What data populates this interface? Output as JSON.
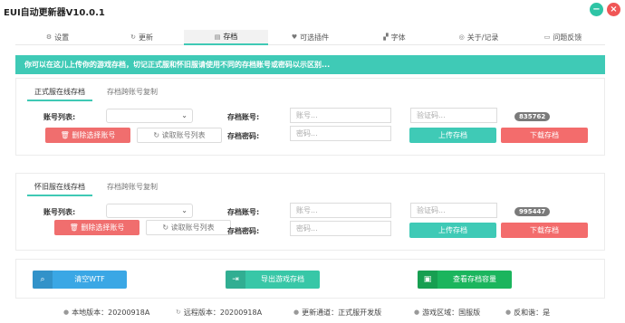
{
  "window": {
    "title": "EUI自动更新器V10.0.1",
    "minimize": "−",
    "close": "×"
  },
  "tabs": [
    {
      "icon": "⚙",
      "label": "设置"
    },
    {
      "icon": "↻",
      "label": "更新"
    },
    {
      "icon": "▤",
      "label": "存档"
    },
    {
      "icon": "♥",
      "label": "可选插件"
    },
    {
      "icon": "▞",
      "label": "字体"
    },
    {
      "icon": "◎",
      "label": "关于/记录"
    },
    {
      "icon": "▭",
      "label": "问题反馈"
    }
  ],
  "notice": "你可以在这儿上传你的游戏存档，切记正式服和怀旧服请使用不同的存档账号或密码以示区别...",
  "panel_official": {
    "subtab_active": "正式服在线存档",
    "subtab_other": "存档跨账号复制",
    "account_list_label": "账号列表:",
    "delete_btn": "删除选择账号",
    "read_btn": "读取账号列表",
    "save_account_label": "存档账号:",
    "save_password_label": "存档密码:",
    "account_placeholder": "账号...",
    "password_placeholder": "密码...",
    "captcha_placeholder": "验证码...",
    "captcha_code": "835762",
    "upload_btn": "上传存档",
    "download_btn": "下载存档"
  },
  "panel_classic": {
    "subtab_active": "怀旧服在线存档",
    "subtab_other": "存档跨账号复制",
    "account_list_label": "账号列表:",
    "delete_btn": "删除选择账号",
    "read_btn": "读取账号列表",
    "save_account_label": "存档账号:",
    "save_password_label": "存档密码:",
    "account_placeholder": "账号...",
    "password_placeholder": "密码...",
    "captcha_placeholder": "验证码...",
    "captcha_code": "995447",
    "upload_btn": "上传存档",
    "download_btn": "下载存档"
  },
  "tools": {
    "clear_wtf": "清空WTF",
    "export_save": "导出游戏存档",
    "view_capacity": "查看存档容量"
  },
  "status": [
    {
      "icon": "●",
      "text": "本地版本：20200918A"
    },
    {
      "icon": "↻",
      "text": "远程版本：20200918A"
    },
    {
      "icon": "●",
      "text": "更新通道：正式服开发版"
    },
    {
      "icon": "●",
      "text": "游戏区域：国服版"
    },
    {
      "icon": "●",
      "text": "反和谐：是"
    }
  ],
  "colors": {
    "accent": "#3fcab6",
    "danger": "#f06e6e",
    "blue": "#3aa7e5",
    "green": "#1bb55d"
  }
}
